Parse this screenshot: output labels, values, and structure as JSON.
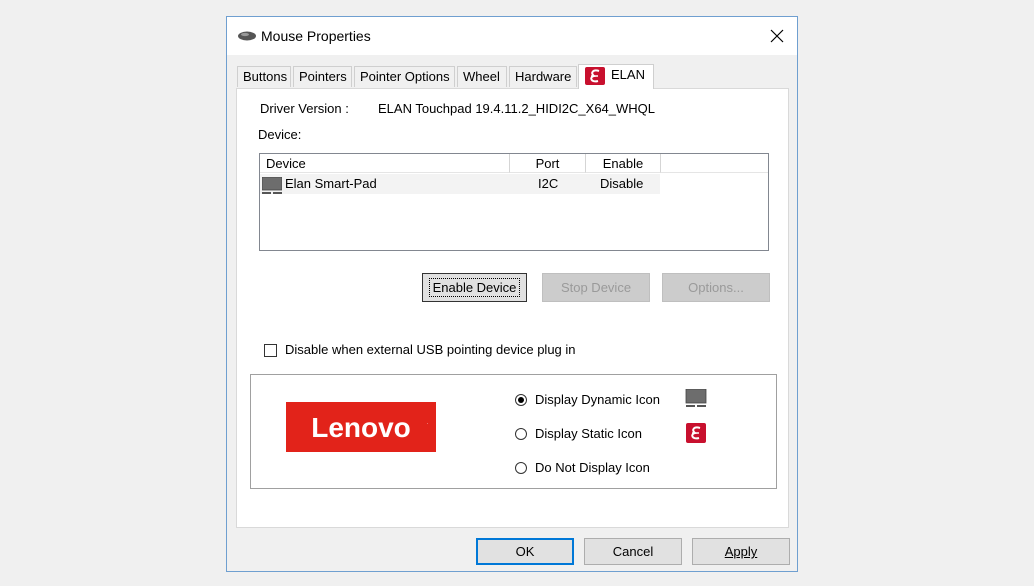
{
  "window": {
    "title": "Mouse Properties",
    "title_icon": "mouse-icon",
    "close_icon": "close-icon"
  },
  "tabs": [
    {
      "label": "Buttons",
      "active": false
    },
    {
      "label": "Pointers",
      "active": false
    },
    {
      "label": "Pointer Options",
      "active": false
    },
    {
      "label": "Wheel",
      "active": false
    },
    {
      "label": "Hardware",
      "active": false
    },
    {
      "label": "ELAN",
      "active": true,
      "icon": "elan-logo-icon"
    }
  ],
  "elan": {
    "driver_version_label": "Driver Version :",
    "driver_version_value": "ELAN Touchpad 19.4.11.2_HIDI2C_X64_WHQL",
    "device_label": "Device:",
    "device_list": {
      "columns": [
        "Device",
        "Port",
        "Enable"
      ],
      "rows": [
        {
          "device": "Elan Smart-Pad",
          "port": "I2C",
          "enable": "Disable",
          "icon": "touchpad-icon"
        }
      ]
    },
    "buttons": {
      "enable_device": "Enable Device",
      "stop_device": "Stop Device",
      "options": "Options..."
    },
    "disable_usb_checkbox": {
      "label": "Disable when external USB pointing device plug in",
      "checked": false
    },
    "logo_text": "Lenovo",
    "icon_options": [
      {
        "label": "Display Dynamic Icon",
        "selected": true,
        "icon": "touchpad-icon"
      },
      {
        "label": "Display Static Icon",
        "selected": false,
        "icon": "elan-logo-icon"
      },
      {
        "label": "Do Not Display Icon",
        "selected": false
      }
    ]
  },
  "dialog_buttons": {
    "ok": "OK",
    "cancel": "Cancel",
    "apply": "Apply"
  },
  "colors": {
    "lenovo_red": "#e2231a",
    "elan_red": "#c8102e",
    "focus_blue": "#0078d7"
  }
}
